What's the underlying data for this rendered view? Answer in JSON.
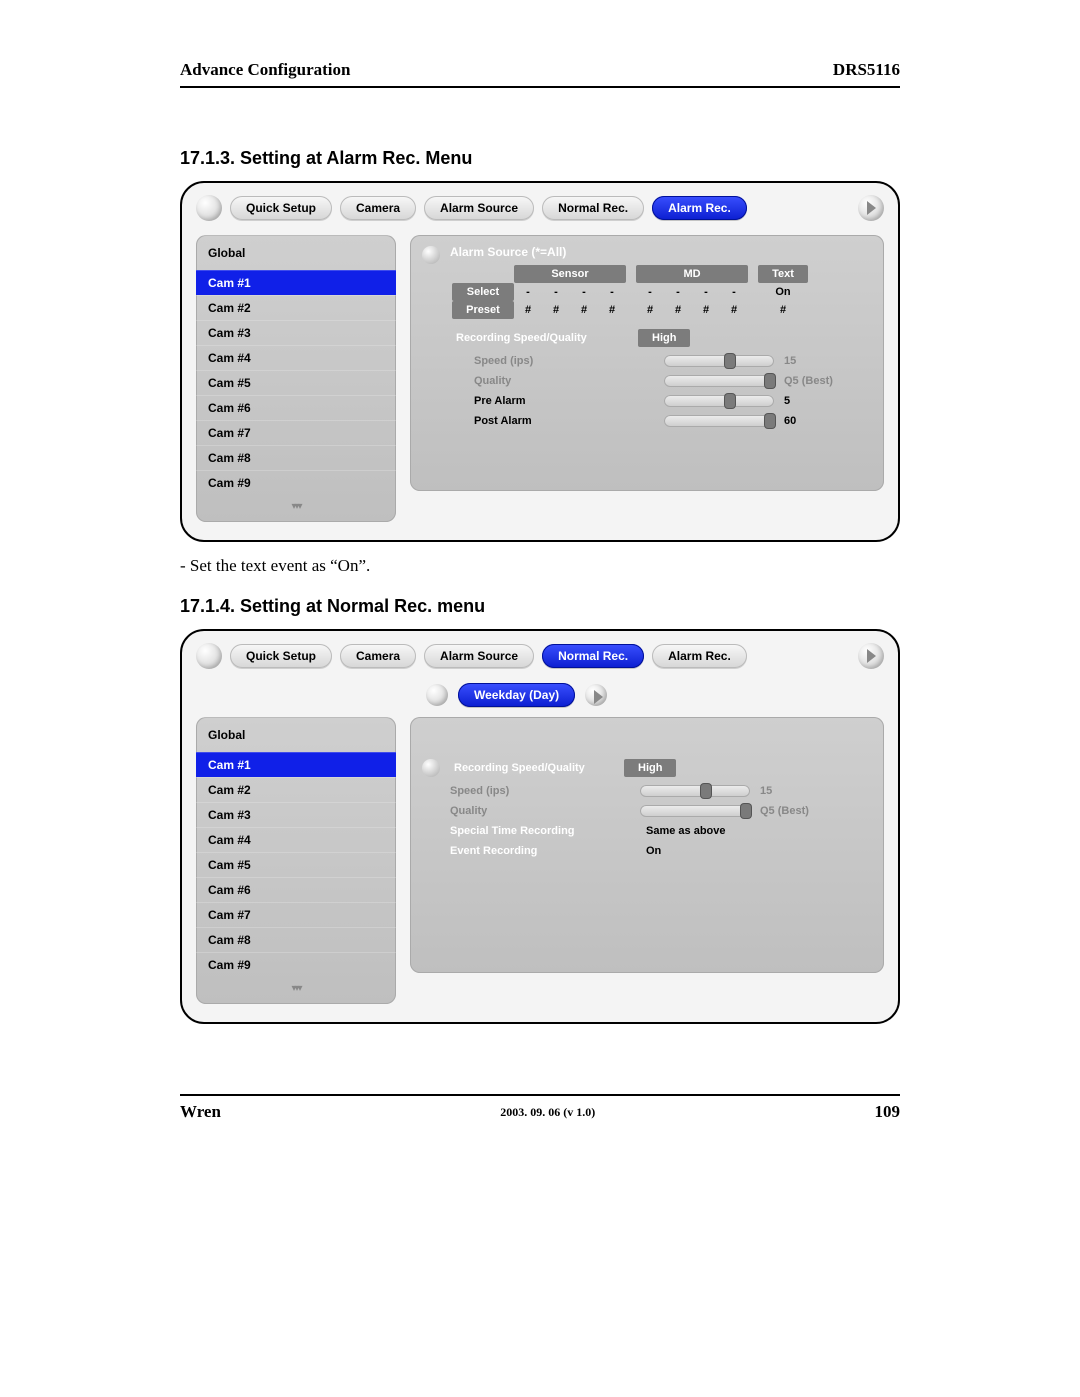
{
  "header": {
    "left": "Advance Configuration",
    "right": "DRS5116"
  },
  "sections": {
    "s1_heading": "17.1.3. Setting at Alarm Rec. Menu",
    "s2_heading": "17.1.4. Setting at Normal Rec. menu",
    "note1": "- Set the text event as “On”."
  },
  "tabs": {
    "quick_setup": "Quick Setup",
    "camera": "Camera",
    "alarm_source": "Alarm Source",
    "normal_rec": "Normal Rec.",
    "alarm_rec": "Alarm Rec."
  },
  "cams": {
    "global": "Global",
    "items": [
      "Cam #1",
      "Cam #2",
      "Cam #3",
      "Cam #4",
      "Cam #5",
      "Cam #6",
      "Cam #7",
      "Cam #8",
      "Cam #9"
    ]
  },
  "alarm_panel": {
    "title": "Alarm Source (*=All)",
    "hdr_sensor": "Sensor",
    "hdr_md": "MD",
    "hdr_text": "Text",
    "row_select": "Select",
    "row_preset": "Preset",
    "select_vals_sensor": [
      "-",
      "-",
      "-",
      "-"
    ],
    "select_vals_md": [
      "-",
      "-",
      "-",
      "-"
    ],
    "select_val_text": "On",
    "preset_vals_sensor": [
      "#",
      "#",
      "#",
      "#"
    ],
    "preset_vals_md": [
      "#",
      "#",
      "#",
      "#"
    ],
    "preset_val_text": "#",
    "rq_label": "Recording Speed/Quality",
    "rq_high": "High",
    "speed_label": "Speed (ips)",
    "speed_val": "15",
    "quality_label": "Quality",
    "quality_val": "Q5 (Best)",
    "prealarm_label": "Pre Alarm",
    "prealarm_val": "5",
    "postalarm_label": "Post Alarm",
    "postalarm_val": "60"
  },
  "normal_panel": {
    "weekday": "Weekday (Day)",
    "rq_label": "Recording Speed/Quality",
    "rq_high": "High",
    "speed_label": "Speed (ips)",
    "speed_val": "15",
    "quality_label": "Quality",
    "quality_val": "Q5 (Best)",
    "special_label": "Special Time Recording",
    "special_val": "Same as above",
    "event_label": "Event Recording",
    "event_val": "On"
  },
  "footer": {
    "left": "Wren",
    "center": "2003. 09. 06 (v 1.0)",
    "right": "109"
  }
}
